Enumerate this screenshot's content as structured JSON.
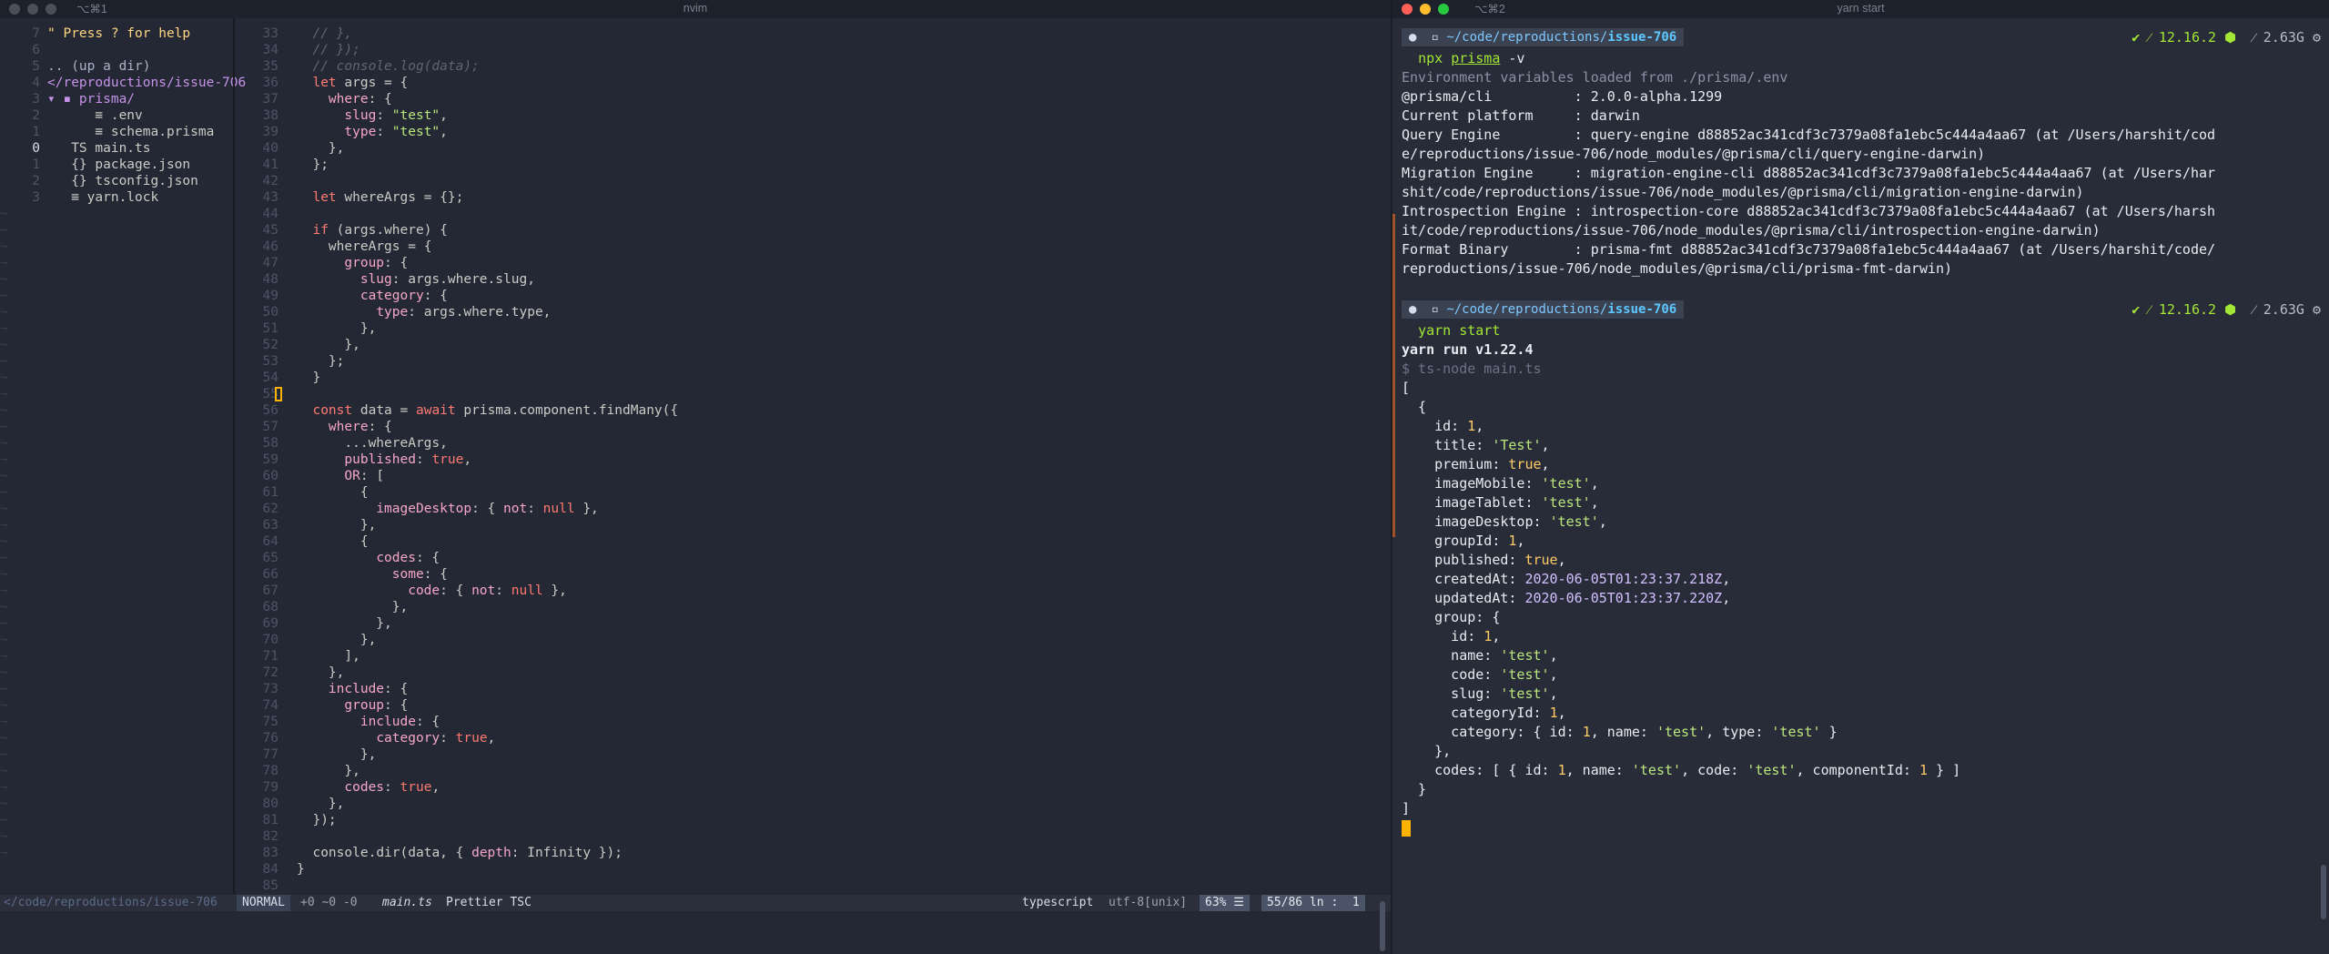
{
  "left_window": {
    "tab_label": "⌥⌘1",
    "title": "nvim",
    "tree": [
      {
        "num": "7",
        "text": "\" Press ? for help",
        "kind": "help"
      },
      {
        "num": "6",
        "text": "",
        "kind": "blank"
      },
      {
        "num": "5",
        "text": ".. (up a dir)",
        "kind": "up"
      },
      {
        "num": "4",
        "text": "</reproductions/issue-706",
        "kind": "dir"
      },
      {
        "num": "3",
        "text": "▾ ▪ prisma/",
        "kind": "folder"
      },
      {
        "num": "2",
        "text": "      ≡ .env",
        "kind": "file"
      },
      {
        "num": "1",
        "text": "      ≡ schema.prisma",
        "kind": "file"
      },
      {
        "num": "0",
        "text": "   TS main.ts",
        "kind": "ts",
        "current": true
      },
      {
        "num": "1",
        "text": "   {} package.json",
        "kind": "json"
      },
      {
        "num": "2",
        "text": "   {} tsconfig.json",
        "kind": "json"
      },
      {
        "num": "3",
        "text": "   ≡ yarn.lock",
        "kind": "file"
      }
    ],
    "code": [
      {
        "num": "33",
        "text": "  // },",
        "kind": "comment"
      },
      {
        "num": "34",
        "text": "  // });",
        "kind": "comment"
      },
      {
        "num": "35",
        "text": "  // console.log(data);",
        "kind": "comment"
      },
      {
        "num": "36",
        "text": "  let args = {",
        "kind": "code"
      },
      {
        "num": "37",
        "text": "    where: {",
        "kind": "code"
      },
      {
        "num": "38",
        "text": "      slug: \"test\",",
        "kind": "code"
      },
      {
        "num": "39",
        "text": "      type: \"test\",",
        "kind": "code"
      },
      {
        "num": "40",
        "text": "    },",
        "kind": "code"
      },
      {
        "num": "41",
        "text": "  };",
        "kind": "code"
      },
      {
        "num": "42",
        "text": "",
        "kind": "code"
      },
      {
        "num": "43",
        "text": "  let whereArgs = {};",
        "kind": "code"
      },
      {
        "num": "44",
        "text": "",
        "kind": "code"
      },
      {
        "num": "45",
        "text": "  if (args.where) {",
        "kind": "code"
      },
      {
        "num": "46",
        "text": "    whereArgs = {",
        "kind": "code"
      },
      {
        "num": "47",
        "text": "      group: {",
        "kind": "code"
      },
      {
        "num": "48",
        "text": "        slug: args.where.slug,",
        "kind": "code"
      },
      {
        "num": "49",
        "text": "        category: {",
        "kind": "code"
      },
      {
        "num": "50",
        "text": "          type: args.where.type,",
        "kind": "code"
      },
      {
        "num": "51",
        "text": "        },",
        "kind": "code"
      },
      {
        "num": "52",
        "text": "      },",
        "kind": "code"
      },
      {
        "num": "53",
        "text": "    };",
        "kind": "code"
      },
      {
        "num": "54",
        "text": "  }",
        "kind": "code"
      },
      {
        "num": "55",
        "text": "",
        "kind": "cursor"
      },
      {
        "num": "56",
        "text": "  const data = await prisma.component.findMany({",
        "kind": "code"
      },
      {
        "num": "57",
        "text": "    where: {",
        "kind": "code"
      },
      {
        "num": "58",
        "text": "      ...whereArgs,",
        "kind": "code"
      },
      {
        "num": "59",
        "text": "      published: true,",
        "kind": "code"
      },
      {
        "num": "60",
        "text": "      OR: [",
        "kind": "code"
      },
      {
        "num": "61",
        "text": "        {",
        "kind": "code"
      },
      {
        "num": "62",
        "text": "          imageDesktop: { not: null },",
        "kind": "code"
      },
      {
        "num": "63",
        "text": "        },",
        "kind": "code"
      },
      {
        "num": "64",
        "text": "        {",
        "kind": "code"
      },
      {
        "num": "65",
        "text": "          codes: {",
        "kind": "code"
      },
      {
        "num": "66",
        "text": "            some: {",
        "kind": "code"
      },
      {
        "num": "67",
        "text": "              code: { not: null },",
        "kind": "code"
      },
      {
        "num": "68",
        "text": "            },",
        "kind": "code"
      },
      {
        "num": "69",
        "text": "          },",
        "kind": "code"
      },
      {
        "num": "70",
        "text": "        },",
        "kind": "code"
      },
      {
        "num": "71",
        "text": "      ],",
        "kind": "code"
      },
      {
        "num": "72",
        "text": "    },",
        "kind": "code"
      },
      {
        "num": "73",
        "text": "    include: {",
        "kind": "code"
      },
      {
        "num": "74",
        "text": "      group: {",
        "kind": "code"
      },
      {
        "num": "75",
        "text": "        include: {",
        "kind": "code"
      },
      {
        "num": "76",
        "text": "          category: true,",
        "kind": "code"
      },
      {
        "num": "77",
        "text": "        },",
        "kind": "code"
      },
      {
        "num": "78",
        "text": "      },",
        "kind": "code"
      },
      {
        "num": "79",
        "text": "      codes: true,",
        "kind": "code"
      },
      {
        "num": "80",
        "text": "    },",
        "kind": "code"
      },
      {
        "num": "81",
        "text": "  });",
        "kind": "code"
      },
      {
        "num": "82",
        "text": "",
        "kind": "code"
      },
      {
        "num": "83",
        "text": "  console.dir(data, { depth: Infinity });",
        "kind": "code"
      },
      {
        "num": "84",
        "text": "}",
        "kind": "code"
      },
      {
        "num": "85",
        "text": "",
        "kind": "code"
      }
    ],
    "statusline": {
      "cwd": "</code/reproductions/issue-706",
      "mode": "NORMAL",
      "git": "+0 ~0 -0",
      "filename": "main.ts",
      "plugins": "Prettier TSC",
      "filetype": "typescript",
      "encoding": "utf-8[unix]",
      "percent": "63% ☰",
      "position": "55/86 ln :  1"
    }
  },
  "right_window": {
    "tab_label": "⌥⌘2",
    "title": "yarn start",
    "prompt_path_prefix": "~/code/reproductions/",
    "prompt_path_dir": "issue-706",
    "prompt_node": "✔ ⁄ 12.16.2 ⬢",
    "prompt_mem": "⁄ 2.63G ⚙",
    "cmd1": "npx",
    "cmd1_rest_u": "prisma",
    "cmd1_rest": " -v",
    "prisma_output": [
      "Environment variables loaded from ./prisma/.env",
      "@prisma/cli          : 2.0.0-alpha.1299",
      "Current platform     : darwin",
      "Query Engine         : query-engine d88852ac341cdf3c7379a08fa1ebc5c444a4aa67 (at /Users/harshit/cod",
      "e/reproductions/issue-706/node_modules/@prisma/cli/query-engine-darwin)",
      "Migration Engine     : migration-engine-cli d88852ac341cdf3c7379a08fa1ebc5c444a4aa67 (at /Users/har",
      "shit/code/reproductions/issue-706/node_modules/@prisma/cli/migration-engine-darwin)",
      "Introspection Engine : introspection-core d88852ac341cdf3c7379a08fa1ebc5c444a4aa67 (at /Users/harsh",
      "it/code/reproductions/issue-706/node_modules/@prisma/cli/introspection-engine-darwin)",
      "Format Binary        : prisma-fmt d88852ac341cdf3c7379a08fa1ebc5c444a4aa67 (at /Users/harshit/code/",
      "reproductions/issue-706/node_modules/@prisma/cli/prisma-fmt-darwin)"
    ],
    "cmd2": "yarn start",
    "yarn_run": "yarn run v1.22.4",
    "ts_node": "$ ts-node main.ts",
    "output": [
      "[",
      "  {",
      "    id: 1,",
      "    title: 'Test',",
      "    premium: true,",
      "    imageMobile: 'test',",
      "    imageTablet: 'test',",
      "    imageDesktop: 'test',",
      "    groupId: 1,",
      "    published: true,",
      "    createdAt: 2020-06-05T01:23:37.218Z,",
      "    updatedAt: 2020-06-05T01:23:37.220Z,",
      "    group: {",
      "      id: 1,",
      "      name: 'test',",
      "      code: 'test',",
      "      slug: 'test',",
      "      categoryId: 1,",
      "      category: { id: 1, name: 'test', type: 'test' }",
      "    },",
      "    codes: [ { id: 1, name: 'test', code: 'test', componentId: 1 } ]",
      "  }",
      "]"
    ]
  }
}
